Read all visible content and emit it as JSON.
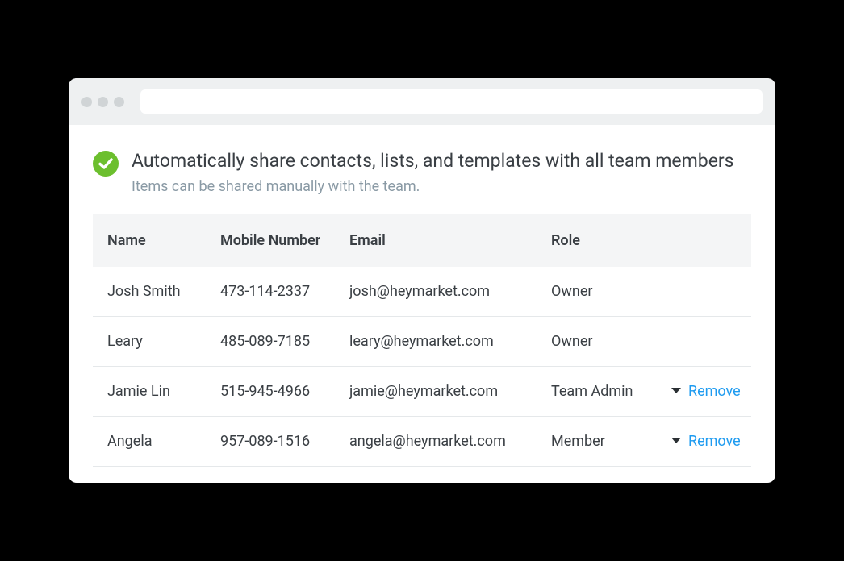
{
  "notice": {
    "title": "Automatically share contacts, lists, and templates with all team members",
    "subtitle": "Items can be shared manually with the team."
  },
  "table": {
    "headers": {
      "name": "Name",
      "mobile": "Mobile Number",
      "email": "Email",
      "role": "Role"
    },
    "rows": [
      {
        "name": "Josh Smith",
        "mobile": "473-114-2337",
        "email": "josh@heymarket.com",
        "role": "Owner",
        "editable": false
      },
      {
        "name": "Leary",
        "mobile": "485-089-7185",
        "email": "leary@heymarket.com",
        "role": "Owner",
        "editable": false
      },
      {
        "name": "Jamie Lin",
        "mobile": "515-945-4966",
        "email": "jamie@heymarket.com",
        "role": "Team Admin",
        "editable": true
      },
      {
        "name": "Angela",
        "mobile": "957-089-1516",
        "email": "angela@heymarket.com",
        "role": "Member",
        "editable": true
      }
    ],
    "removeLabel": "Remove"
  }
}
